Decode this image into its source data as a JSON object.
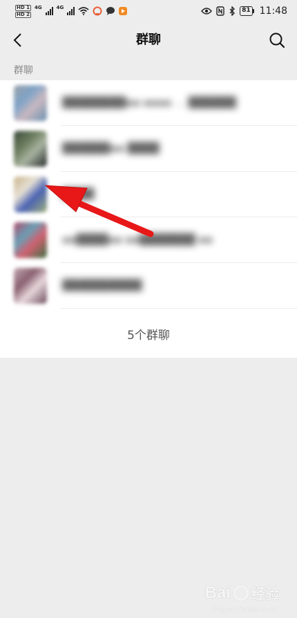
{
  "status_bar": {
    "sim1": "HD 1",
    "sim2": "HD 2",
    "network1": "4G",
    "network2": "4G",
    "battery": "81",
    "time": "11:48",
    "app_icons": [
      "bubble-icon",
      "chat-icon",
      "play-icon"
    ]
  },
  "nav": {
    "title": "群聊",
    "back_icon": "chevron-left-icon",
    "search_icon": "search-icon"
  },
  "section_label": "群聊",
  "groups": [
    {
      "name": "████████▪▪ ▪▪▪▪ … ██████",
      "avatar_colors": [
        "#9aa0a8",
        "#7fa3c7",
        "#c8b8c0",
        "#6a8fb0"
      ]
    },
    {
      "name": "██████▪▪ ████",
      "avatar_colors": [
        "#3c4a3c",
        "#6b7d5e",
        "#a9b3a0",
        "#23282a"
      ]
    },
    {
      "name": "████",
      "avatar_colors": [
        "#c9b38a",
        "#e6e0d4",
        "#4a63b3",
        "#9fb07a"
      ]
    },
    {
      "name": "▪▪████▪▪ ▪▪███████ ▪▪",
      "avatar_colors": [
        "#b04a6a",
        "#6a9fb5",
        "#d06070",
        "#3a7040"
      ]
    },
    {
      "name": "██████████",
      "avatar_colors": [
        "#c0a8b0",
        "#8a6070",
        "#e8d8dc",
        "#6a4a5a"
      ]
    }
  ],
  "footer_count": "5个群聊",
  "colors": {
    "background": "#ededed",
    "list_background": "#ffffff",
    "arrow": "#e81818"
  },
  "watermark": {
    "logo": "Bai",
    "text": "经验",
    "sub": "jingyan.baidu.com"
  }
}
